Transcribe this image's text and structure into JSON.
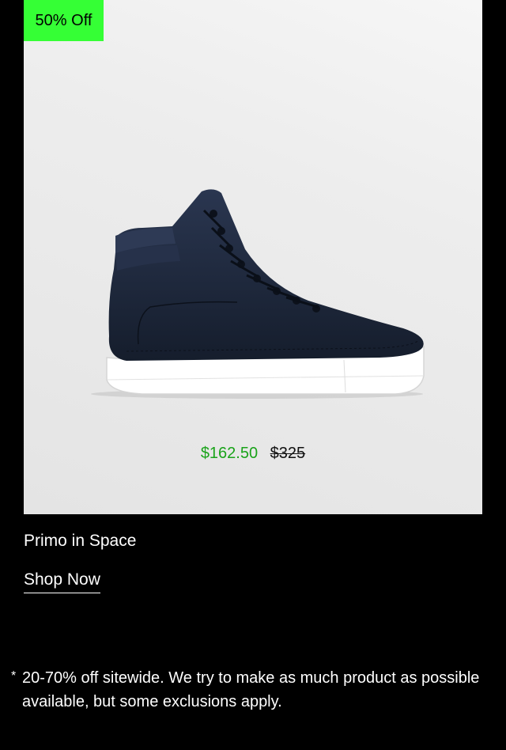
{
  "badge": {
    "label": "50% Off",
    "color": "#35ff35"
  },
  "product": {
    "sale_price": "$162.50",
    "original_price": "$325",
    "name": "Primo in Space",
    "image": "navy high-top leather sneaker with white sole"
  },
  "cta": {
    "label": "Shop Now"
  },
  "footnote": {
    "mark": "*",
    "text": "20-70% off sitewide. We try to make as much product as possible available, but some exclusions apply."
  },
  "colors": {
    "sale_price": "#1aa31a",
    "background": "#000000",
    "shoe": "#1f2a3d"
  }
}
